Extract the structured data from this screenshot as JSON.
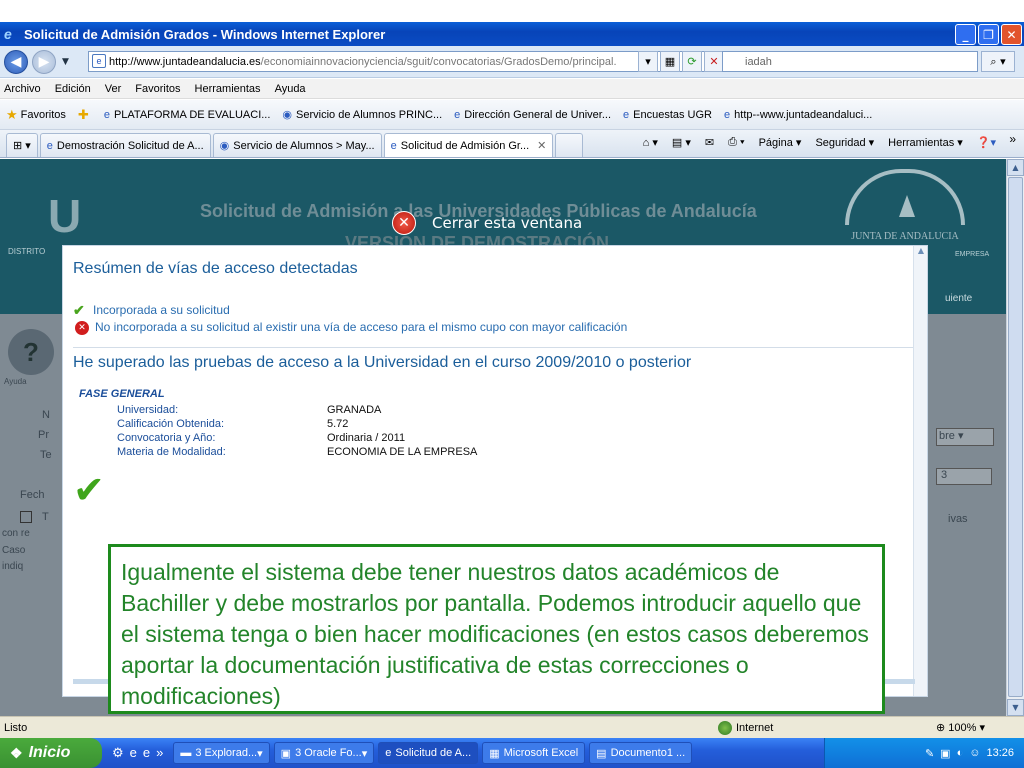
{
  "window": {
    "title": "Solicitud de Admisión Grados - Windows Internet Explorer",
    "controls": {
      "minimize": "_",
      "restore": "❐",
      "close": "✕"
    }
  },
  "address": {
    "url_domain": "http://www.juntadeandalucia.es",
    "url_path": "/economiainnovacionyciencia/sguit/convocatorias/GradosDemo/principal.",
    "search_value": "iadah"
  },
  "menu": [
    "Archivo",
    "Edición",
    "Ver",
    "Favoritos",
    "Herramientas",
    "Ayuda"
  ],
  "favorites": {
    "label": "Favoritos",
    "items": [
      "PLATAFORMA DE EVALUACI...",
      "Servicio de Alumnos PRINC...",
      "Dirección General de Univer...",
      "Encuestas UGR",
      "http--www.juntadeandaluci..."
    ]
  },
  "tabs": [
    {
      "label": "Demostración Solicitud de A..."
    },
    {
      "label": "Servicio de Alumnos > May..."
    },
    {
      "label": "Solicitud de Admisión Gr..."
    }
  ],
  "tab_tools": {
    "pagina": "Página",
    "seguridad": "Seguridad",
    "herramientas": "Herramientas",
    "more": "»"
  },
  "banner": {
    "logo_letter": "U",
    "distrito": "DISTRITO",
    "title": "Solicitud de Admisión a las Universidades Públicas de Andalucía",
    "subtitle": "VERSIÓN DE DEMOSTRACIÓN",
    "junta": "JUNTA DE ANDALUCIA",
    "empresa": "EMPRESA",
    "siguiente": "uiente"
  },
  "background": {
    "ayuda": "Ayuda",
    "fecha": "Fech",
    "con_re": "con re",
    "caso": "Caso",
    "indiq": "indiq",
    "bre": "bre",
    "tres": "3",
    "ivas": "ivas"
  },
  "close_window": "Cerrar esta ventana",
  "modal": {
    "title": "Resúmen de vías de acceso detectadas",
    "legend_ok": "Incorporada a su solicitud",
    "legend_no": "No incorporada a su solicitud al existir una vía de acceso para el mismo cupo con mayor calificación",
    "heading": "He superado las pruebas de acceso a la Universidad en el curso 2009/2010 o posterior",
    "fase": "FASE GENERAL",
    "rows": [
      {
        "k": "Universidad:",
        "v": "GRANADA"
      },
      {
        "k": "Calificación Obtenida:",
        "v": "5.72"
      },
      {
        "k": "Convocatoria y Año:",
        "v": "Ordinaria / 2011"
      },
      {
        "k": "Materia de Modalidad:",
        "v": "ECONOMIA DE LA EMPRESA"
      }
    ]
  },
  "note": "Igualmente el sistema debe tener nuestros datos académicos de Bachiller y debe mostrarlos por pantalla. Podemos introducir aquello que el sistema tenga o bien hacer modificaciones (en estos casos deberemos aportar la documentación justificativa de estas correcciones o modificaciones)",
  "status": {
    "text": "Listo",
    "zone": "Internet",
    "zoom": "100%"
  },
  "taskbar": {
    "start": "Inicio",
    "tasks": [
      "3 Explorad...",
      "3 Oracle Fo...",
      "Solicitud de A...",
      "Microsoft Excel",
      "Documento1 ..."
    ],
    "clock": "13:26"
  }
}
